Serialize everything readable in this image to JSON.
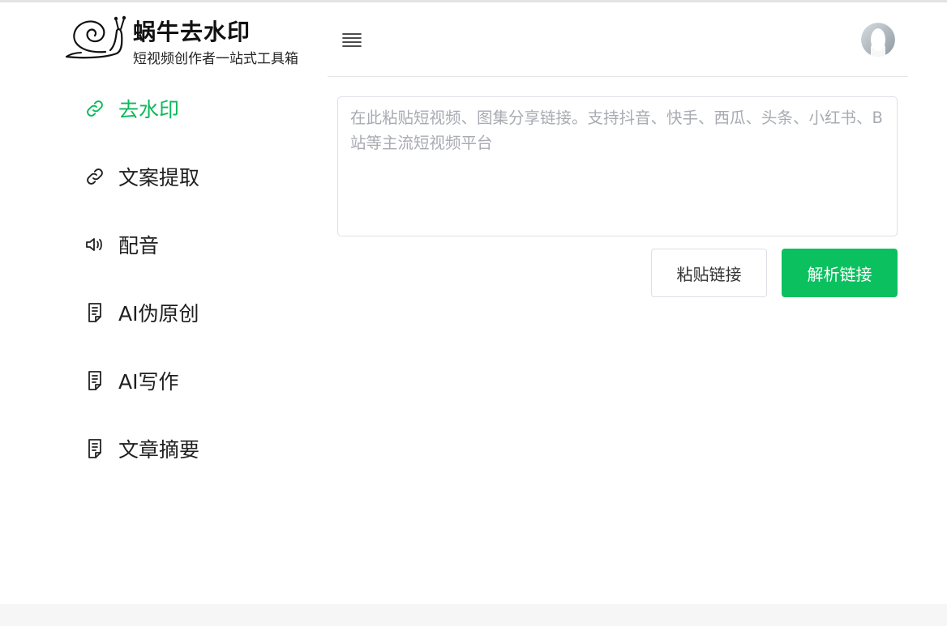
{
  "logo": {
    "title": "蜗牛去水印",
    "subtitle": "短视频创作者一站式工具箱",
    "icon": "snail-icon"
  },
  "colors": {
    "accent": "#0bc15f",
    "active_text": "#0bb95a",
    "border": "#dcdfe6",
    "placeholder": "#a8abb2"
  },
  "sidebar": {
    "items": [
      {
        "label": "去水印",
        "icon": "link-icon",
        "active": true
      },
      {
        "label": "文案提取",
        "icon": "link-icon",
        "active": false
      },
      {
        "label": "配音",
        "icon": "speaker-icon",
        "active": false
      },
      {
        "label": "AI伪原创",
        "icon": "document-icon",
        "active": false
      },
      {
        "label": "AI写作",
        "icon": "document-icon",
        "active": false
      },
      {
        "label": "文章摘要",
        "icon": "document-icon",
        "active": false
      }
    ]
  },
  "header": {
    "menu_icon": "hamburger-menu-icon",
    "avatar_icon": "user-avatar"
  },
  "main": {
    "link_input": {
      "value": "",
      "placeholder": "在此粘贴短视频、图集分享链接。支持抖音、快手、西瓜、头条、小红书、B站等主流短视频平台"
    },
    "paste_button": "粘贴链接",
    "parse_button": "解析链接"
  }
}
